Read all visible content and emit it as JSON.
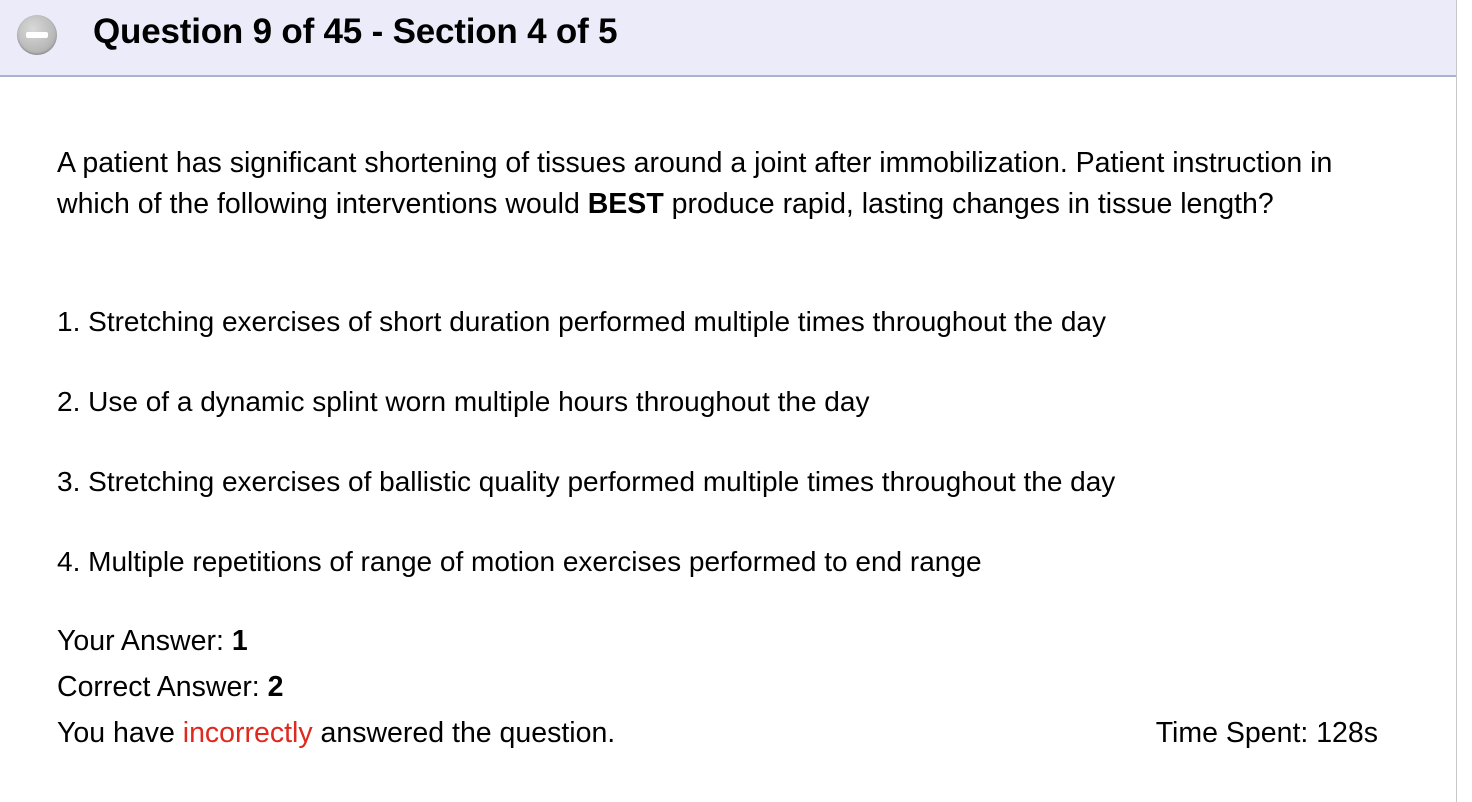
{
  "header": {
    "title": "Question 9 of 45 - Section 4 of 5",
    "collapse_icon": "minus-circle-icon",
    "background": "#ebebf9"
  },
  "question": {
    "stem_before": "A patient has significant shortening of tissues around a joint after immobilization. Patient instruction in which of the following interventions would ",
    "stem_emphasis": "BEST",
    "stem_after": " produce rapid, lasting changes in tissue length?",
    "options": [
      {
        "number": "1.",
        "text": "Stretching exercises of short duration performed multiple times throughout the day"
      },
      {
        "number": "2.",
        "text": "Use of a dynamic splint worn multiple hours throughout the day"
      },
      {
        "number": "3.",
        "text": "Stretching exercises of ballistic quality performed multiple times throughout the day"
      },
      {
        "number": "4.",
        "text": "Multiple repetitions of range of motion exercises performed to end range"
      }
    ]
  },
  "results": {
    "your_answer_label": "Your Answer: ",
    "your_answer_value": "1",
    "correct_answer_label": "Correct Answer: ",
    "correct_answer_value": "2",
    "feedback_before": "You have ",
    "feedback_status": "incorrectly",
    "feedback_after": " answered the question.",
    "status_color": "#e0281e",
    "time_spent": "Time Spent: 128s"
  }
}
